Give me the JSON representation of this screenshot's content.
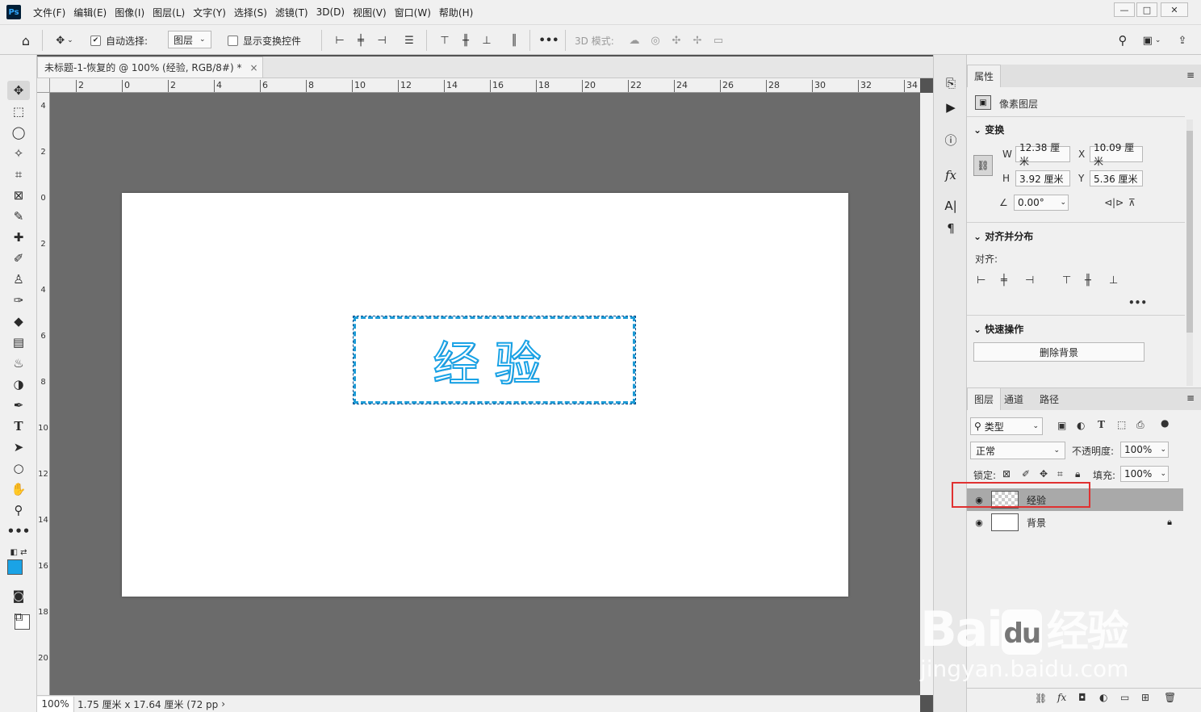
{
  "app": {
    "logo": "Ps"
  },
  "menu": [
    "文件(F)",
    "编辑(E)",
    "图像(I)",
    "图层(L)",
    "文字(Y)",
    "选择(S)",
    "滤镜(T)",
    "3D(D)",
    "视图(V)",
    "窗口(W)",
    "帮助(H)"
  ],
  "window_controls": {
    "minimize": "—",
    "restore": "□",
    "close": "✕"
  },
  "options": {
    "auto_select_label": "自动选择:",
    "auto_select_value": "图层",
    "show_transform_label": "显示变换控件",
    "mode3d_label": "3D 模式:"
  },
  "document": {
    "tab_title": "未标题-1-恢复的 @ 100% (经验, RGB/8#) *",
    "tab_close": "×",
    "canvas_text": "经验",
    "hruler_ticks": [
      "2",
      "0",
      "2",
      "4",
      "6",
      "8",
      "10",
      "12",
      "14",
      "16",
      "18",
      "20",
      "22",
      "24",
      "26",
      "28",
      "30",
      "32",
      "34"
    ],
    "vruler_ticks": [
      "4",
      "2",
      "0",
      "2",
      "4",
      "6",
      "8",
      "10",
      "12",
      "14",
      "16",
      "18",
      "20"
    ]
  },
  "status": {
    "zoom": "100%",
    "info": "1.75 厘米 x 17.64 厘米 (72 pp",
    "arrow": "›"
  },
  "properties": {
    "tab": "属性",
    "layer_type": "像素图层",
    "transform_title": "变换",
    "w_label": "W",
    "w_value": "12.38 厘米",
    "h_label": "H",
    "h_value": "3.92 厘米",
    "x_label": "X",
    "x_value": "10.09 厘米",
    "y_label": "Y",
    "y_value": "5.36 厘米",
    "angle_value": "0.00°",
    "align_title": "对齐并分布",
    "align_label": "对齐:",
    "quick_title": "快速操作",
    "remove_bg": "删除背景"
  },
  "layers_panel": {
    "tabs": [
      "图层",
      "通道",
      "路径"
    ],
    "filter_label": "类型",
    "blend_mode": "正常",
    "opacity_label": "不透明度:",
    "opacity_value": "100%",
    "lock_label": "锁定:",
    "fill_label": "填充:",
    "fill_value": "100%",
    "layers": [
      {
        "name": "经验",
        "selected": true
      },
      {
        "name": "背景",
        "selected": false
      }
    ]
  },
  "watermark": {
    "brand": "Bai",
    "brand2": "du",
    "cn": "经验",
    "url": "jingyan.baidu.com"
  },
  "colors": {
    "foreground": "#1aa3e6",
    "background": "#ffffff",
    "highlight": "#e03131"
  }
}
